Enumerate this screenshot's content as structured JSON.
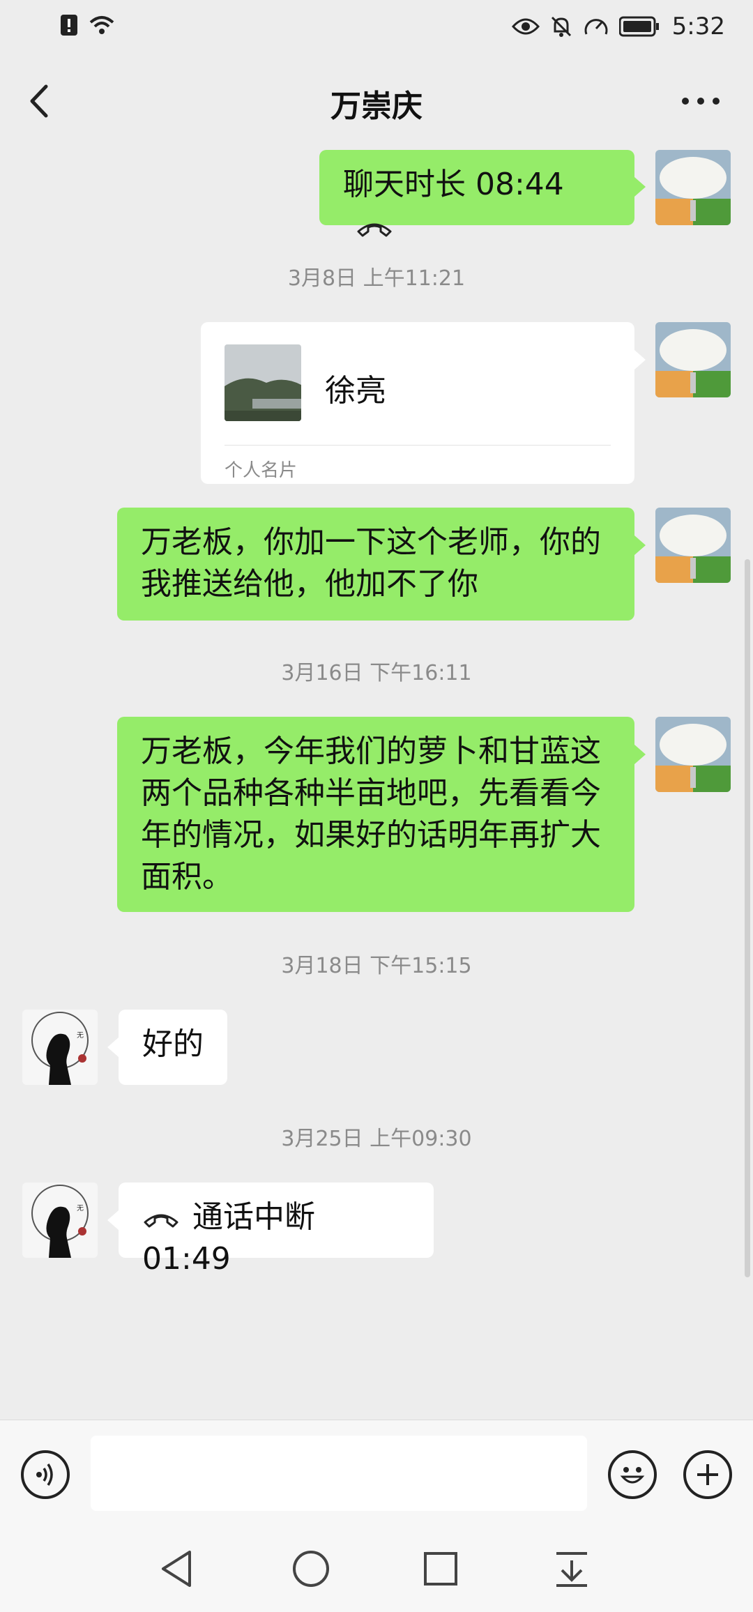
{
  "status_bar": {
    "time": "5:32",
    "icons": [
      "alert-icon",
      "wifi-icon",
      "eye-icon",
      "bell-muted-icon",
      "speedometer-icon",
      "battery-icon"
    ]
  },
  "header": {
    "title": "万崇庆",
    "back_icon": "chevron-left-icon",
    "more_icon": "more-dots-icon"
  },
  "messages": [
    {
      "side": "right",
      "type": "call",
      "text": "聊天时长 08:44",
      "icon": "phone-hangup-icon"
    },
    {
      "type": "timestamp",
      "text": "3月8日 上午11:21"
    },
    {
      "side": "right",
      "type": "contact_card",
      "name": "徐亮",
      "label": "个人名片"
    },
    {
      "side": "right",
      "type": "text",
      "lines": [
        "万老板，你加一下这个老师，你的",
        "我推送给他，他加不了你"
      ]
    },
    {
      "type": "timestamp",
      "text": "3月16日 下午16:11"
    },
    {
      "side": "right",
      "type": "text",
      "lines": [
        "万老板，今年我们的萝卜和甘蓝这",
        "两个品种各种半亩地吧，先看看今",
        "年的情况，如果好的话明年再扩大",
        "面积。"
      ]
    },
    {
      "type": "timestamp",
      "text": "3月18日 下午15:15"
    },
    {
      "side": "left",
      "type": "text",
      "lines": [
        "好的"
      ]
    },
    {
      "type": "timestamp",
      "text": "3月25日 上午09:30"
    },
    {
      "side": "left",
      "type": "call",
      "text": "通话中断 01:49",
      "icon": "phone-hangup-icon"
    }
  ],
  "input_bar": {
    "voice_icon": "voice-icon",
    "text_value": "",
    "emoji_icon": "emoji-icon",
    "plus_icon": "plus-icon"
  },
  "nav_bar": {
    "icons": [
      "nav-back-icon",
      "nav-home-icon",
      "nav-recents-icon",
      "nav-notification-icon"
    ]
  },
  "colors": {
    "background": "#ededed",
    "bubble_sent": "#95ec69",
    "bubble_received": "#ffffff",
    "timestamp": "#8a8a8a"
  }
}
